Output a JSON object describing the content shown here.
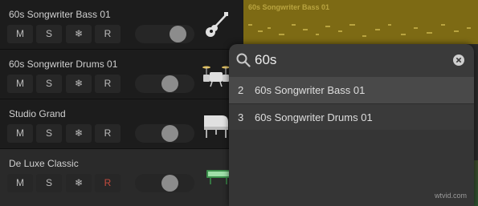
{
  "tracks": [
    {
      "name": "60s Songwriter Bass 01",
      "mute": "M",
      "solo": "S",
      "freeze": "❄",
      "record": "R",
      "record_armed": false,
      "volume": 0.82,
      "icon": "acoustic-guitar-icon"
    },
    {
      "name": "60s Songwriter Drums 01",
      "mute": "M",
      "solo": "S",
      "freeze": "❄",
      "record": "R",
      "record_armed": false,
      "volume": 0.62,
      "icon": "drum-kit-icon"
    },
    {
      "name": "Studio Grand",
      "mute": "M",
      "solo": "S",
      "freeze": "❄",
      "record": "R",
      "record_armed": false,
      "volume": 0.62,
      "icon": "grand-piano-icon"
    },
    {
      "name": "De Luxe Classic",
      "mute": "M",
      "solo": "S",
      "freeze": "❄",
      "record": "R",
      "record_armed": true,
      "volume": 0.62,
      "icon": "keyboard-icon"
    }
  ],
  "timeline": {
    "region_label": "60s Songwriter Bass 01",
    "region_color": "#7d6a14"
  },
  "search": {
    "query": "60s",
    "results": [
      {
        "index": "2",
        "label": "60s Songwriter Bass 01"
      },
      {
        "index": "3",
        "label": "60s Songwriter Drums 01"
      }
    ]
  },
  "watermark": "wtvid.com",
  "colors": {
    "record_armed": "#c24b3d",
    "region_text": "#b9a440"
  }
}
